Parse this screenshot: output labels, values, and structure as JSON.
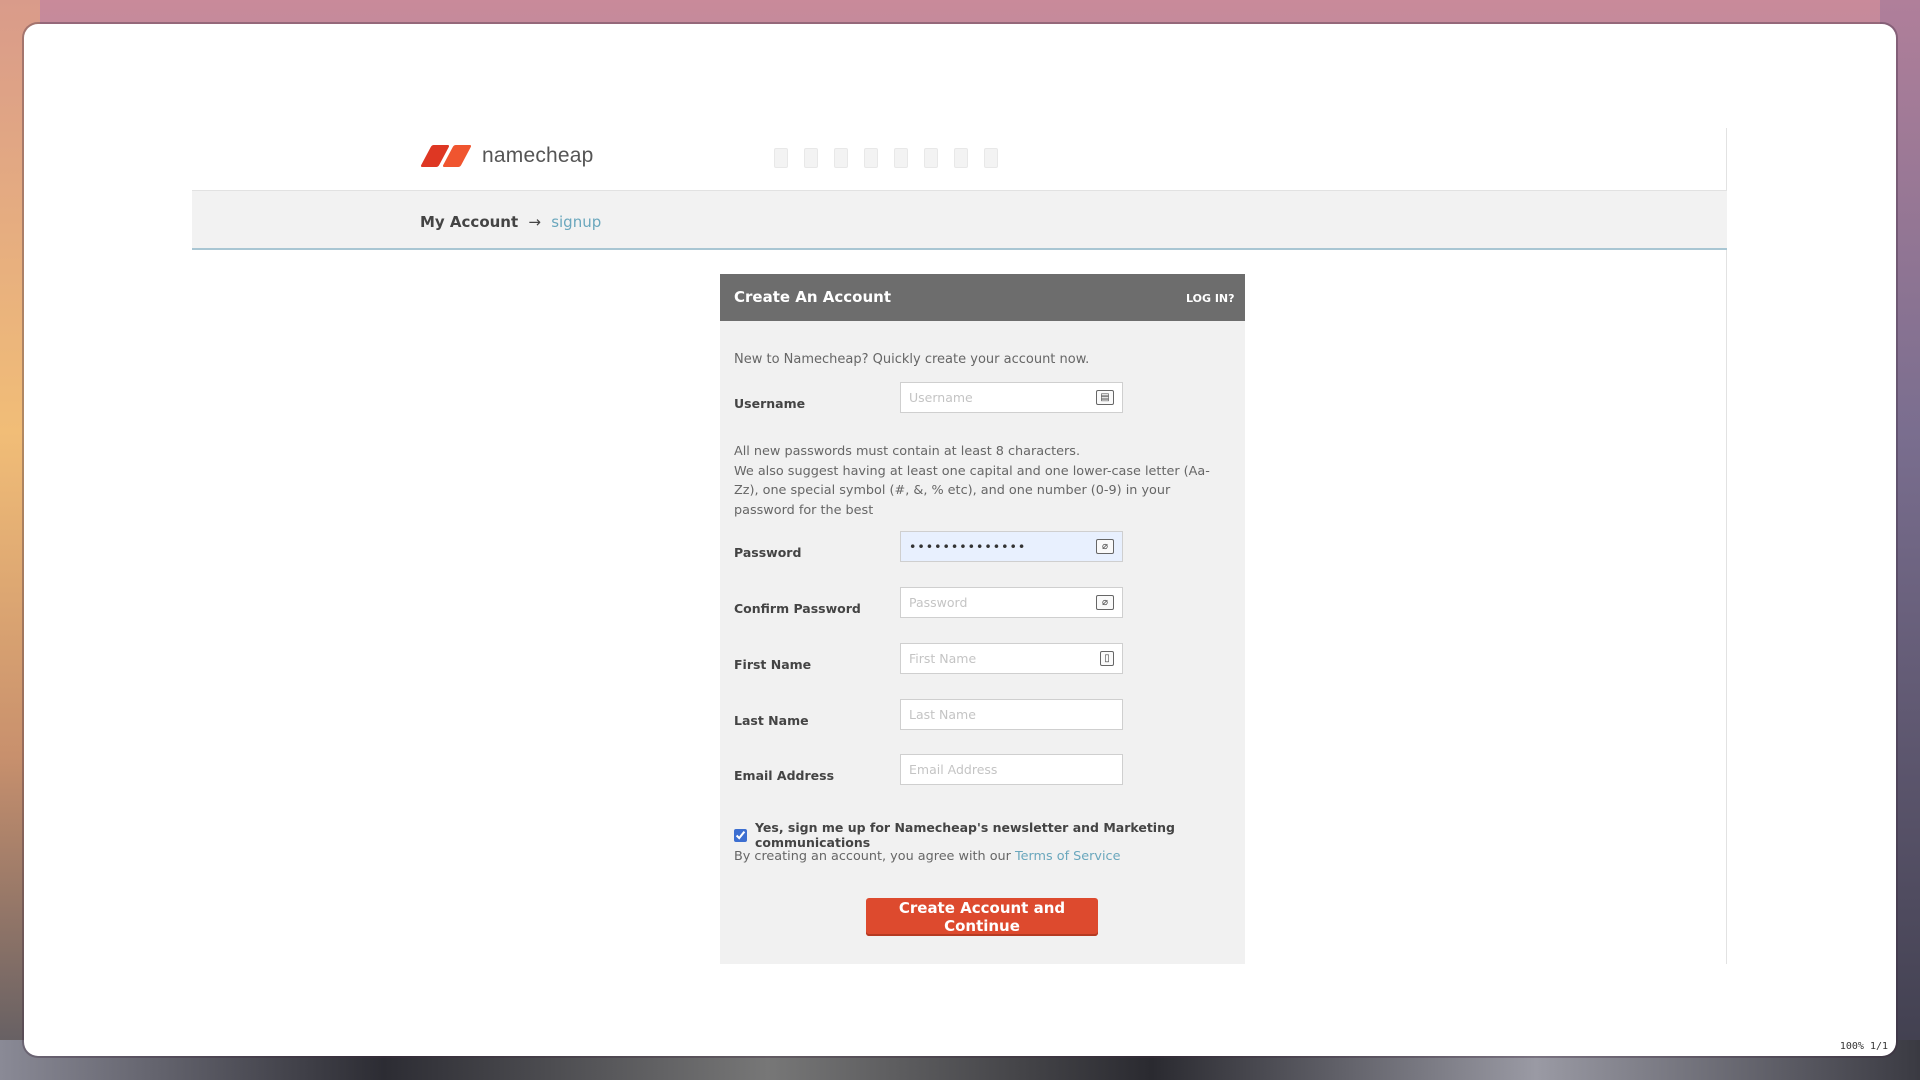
{
  "header": {
    "logo_text": "namecheap",
    "nav_items": [
      "",
      "",
      "",
      "",
      "",
      "",
      "",
      ""
    ]
  },
  "breadcrumb": {
    "root": "My Account",
    "arrow": "→",
    "current": "signup"
  },
  "card": {
    "title": "Create An Account",
    "login_link": "LOG IN?",
    "intro": "New to Namecheap? Quickly create your account now."
  },
  "form": {
    "username": {
      "label": "Username",
      "placeholder": "Username",
      "value": ""
    },
    "password_note": {
      "line1": "All new passwords must contain at least 8 characters.",
      "line2": "We also suggest having at least one capital and one lower-case letter (Aa-Zz), one special symbol (#, &, % etc), and one number (0-9) in your password for the best"
    },
    "password": {
      "label": "Password",
      "placeholder": "Password",
      "value": "••••••••••••••"
    },
    "confirm_password": {
      "label": "Confirm Password",
      "placeholder": "Password",
      "value": ""
    },
    "first_name": {
      "label": "First Name",
      "placeholder": "First Name",
      "value": ""
    },
    "last_name": {
      "label": "Last Name",
      "placeholder": "Last Name",
      "value": ""
    },
    "email": {
      "label": "Email Address",
      "placeholder": "Email Address",
      "value": ""
    },
    "newsletter": {
      "label": "Yes, sign me up for Namecheap's newsletter and Marketing communications",
      "checked": true
    },
    "tos_prefix": "By creating an account, you agree with our",
    "tos_link": "Terms of Service",
    "submit_label": "Create Account and Continue"
  },
  "status_bar": {
    "zoom": "100%",
    "page": "1/1"
  },
  "colors": {
    "accent": "#dd4a2e",
    "header_bg": "#6d6d6d",
    "link": "#6aa7bd"
  }
}
